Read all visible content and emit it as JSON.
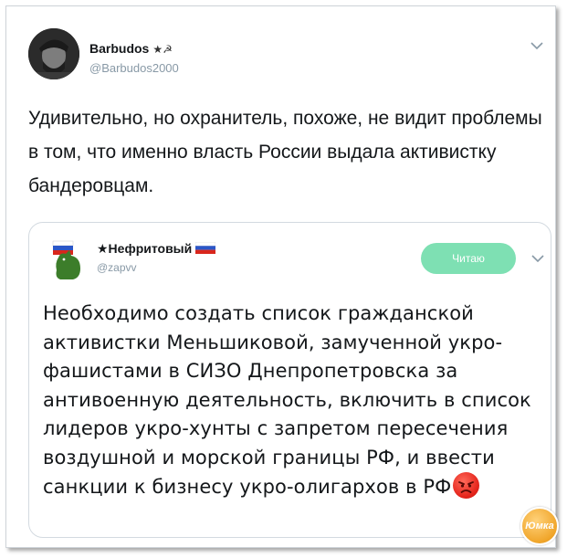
{
  "tweet": {
    "author_name": "Barbudos",
    "author_badge": "★☭",
    "author_handle": "@Barbudos2000",
    "text": "Удивительно, но охранитель, похоже, не видит проблемы в том, что именно власть России выдала активистку бандеровцам."
  },
  "quoted": {
    "name": "★Нефритовый",
    "handle": "@zapvv",
    "follow_label": "Читаю",
    "text": "Необходимо создать список гражданской активистки Меньшиковой, замученной укро-фашистами в СИЗО Днепропетровска за антивоенную деятельность, включить в список лидеров укро-хунты с запретом пересечения воздушной и морской границы РФ, и ввести санкции к бизнесу укро-олигархов в РФ"
  },
  "watermark": "Юмка",
  "colors": {
    "follow_button": "#7ee0b3",
    "handle_gray": "#8899a6",
    "text": "#14171a",
    "border": "#d3dae0"
  },
  "icons": {
    "menu_chevron": "chevron-down-icon",
    "angry_emoji": "angry-face-icon",
    "flag": "russia-flag-icon"
  }
}
